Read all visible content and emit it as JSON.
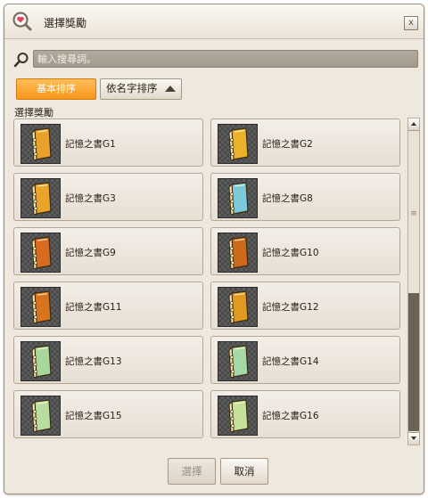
{
  "window": {
    "title": "選擇獎勵",
    "close_label": "x",
    "icon": "heart-magnifier-icon"
  },
  "search": {
    "placeholder": "輸入搜尋詞。",
    "value": "",
    "icon": "search-icon"
  },
  "sort": {
    "basic_label": "基本排序",
    "name_label": "依名字排序",
    "name_arrow": "sort-ascending-icon"
  },
  "section": {
    "label": "選擇獎勵"
  },
  "items": [
    {
      "name": "記憶之書G1",
      "color": "#e9a12a"
    },
    {
      "name": "記憶之書G2",
      "color": "#e9b22a"
    },
    {
      "name": "記憶之書G3",
      "color": "#e9a42a"
    },
    {
      "name": "記憶之書G8",
      "color": "#7cc9d9"
    },
    {
      "name": "記憶之書G9",
      "color": "#d96b1e"
    },
    {
      "name": "記憶之書G10",
      "color": "#cc6a1c"
    },
    {
      "name": "記憶之書G11",
      "color": "#d9741e"
    },
    {
      "name": "記憶之書G12",
      "color": "#e09a22"
    },
    {
      "name": "記憶之書G13",
      "color": "#a9d69a"
    },
    {
      "name": "記憶之書G14",
      "color": "#a6d8a8"
    },
    {
      "name": "記憶之書G15",
      "color": "#b9dca0"
    },
    {
      "name": "記憶之書G16",
      "color": "#c6e09c"
    }
  ],
  "buttons": {
    "select_label": "選擇",
    "cancel_label": "取消"
  },
  "colors": {
    "accent_orange": "#f6961c",
    "panel": "#efe8de"
  }
}
